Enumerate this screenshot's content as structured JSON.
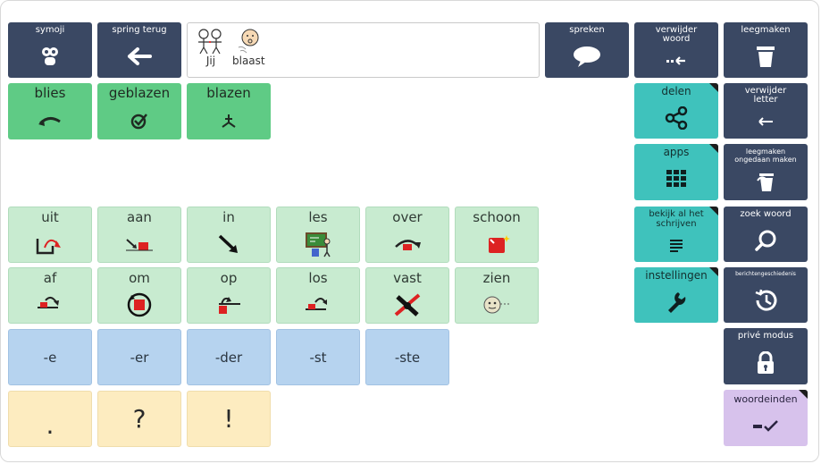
{
  "toolbar": {
    "symoji": "symoji",
    "back": "spring terug",
    "speak": "spreken",
    "delete_word": "verwijder\nwoord",
    "clear": "leegmaken"
  },
  "sentence": [
    "Jij",
    "blaast"
  ],
  "verb_forms": [
    "blies",
    "geblazen",
    "blazen"
  ],
  "particles_row1": [
    "uit",
    "aan",
    "in",
    "les",
    "over",
    "schoon"
  ],
  "particles_row2": [
    "af",
    "om",
    "op",
    "los",
    "vast",
    "zien"
  ],
  "suffixes": [
    "-e",
    "-er",
    "-der",
    "-st",
    "-ste"
  ],
  "punctuation": [
    ".",
    "?",
    "!"
  ],
  "teal_buttons": {
    "share": "delen",
    "apps": "apps",
    "view_all": "bekijk al het\nschrijven",
    "settings": "instellingen"
  },
  "right_column": {
    "delete_letter": "verwijder\nletter",
    "undo_clear": "leegmaken\nongedaan maken",
    "search_word": "zoek woord",
    "message_history": "berichtengeschiedenis",
    "private_mode": "privé modus",
    "word_endings": "woordeinden"
  },
  "colors": {
    "dark": "#3a4863",
    "green": "#5fcb85",
    "light_green": "#c8ebd0",
    "teal": "#3fc2bc",
    "blue": "#b6d3ef",
    "cream": "#fdecc0",
    "lilac": "#d7c2ec"
  }
}
